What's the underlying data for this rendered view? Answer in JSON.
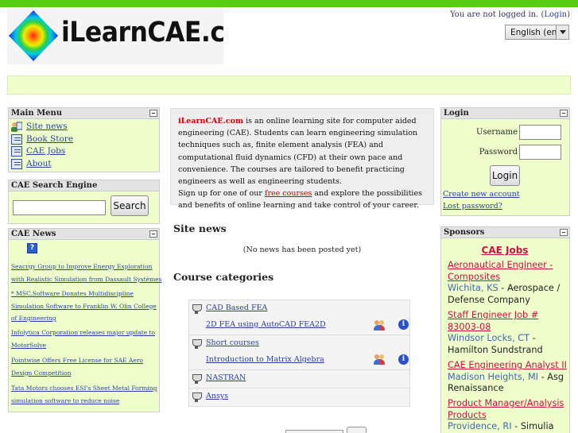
{
  "header": {
    "logo_text": "iLearnCAE.com",
    "login_status": "You are not logged in.",
    "login_link": "Login",
    "language": "English (en)"
  },
  "main_menu": {
    "title": "Main Menu",
    "items": [
      {
        "label": "Site news",
        "icon": "news-icon"
      },
      {
        "label": "Book Store",
        "icon": "document-icon"
      },
      {
        "label": "CAE Jobs",
        "icon": "document-icon"
      },
      {
        "label": "About",
        "icon": "document-icon"
      }
    ]
  },
  "search_block": {
    "title": "CAE Search Engine",
    "button": "Search",
    "query": ""
  },
  "news_block": {
    "title": "CAE News",
    "items": [
      "Seacrgy Group to Improve Energy Exploration with Realistic Simulation from Dassault Systèmes",
      "* MSC.Software Donates Multidiscipline Simulation Software to Franklin W. Olin College of Engineering",
      "Infolytica Corporation releases major update to MotorSolve",
      "Pointwise Offers Free License for SAE Aero Design Competition",
      "Tata Motors chooses ESI's Sheet Metal Forming simulation software to reduce noise"
    ]
  },
  "intro": {
    "brand": "iLearnCAE.com",
    "text1": " is an online learning site for computer aided engineering (CAE). Students can learn engineering simulation techniques such as, finite element analysis (FEA) and computational fluid dynamics (CFD) at their own pace and convenience. The courses are tailored to benefit practicing engineers as well as engineering students.",
    "text2": "Sign up for one of our ",
    "link": "free courses",
    "text3": " and explore the possibilities and benefits of online learning and take control of your career."
  },
  "site_news": {
    "title": "Site news",
    "empty": "(No news has been posted yet)"
  },
  "categories": {
    "title": "Course categories",
    "rows": [
      {
        "name": "CAD Based FEA",
        "course": "2D FEA using AutoCAD FEA2D"
      },
      {
        "name": "Short courses",
        "course": "Introduction to Matrix Algebra"
      },
      {
        "name": "NASTRAN"
      },
      {
        "name": "Ansys"
      }
    ]
  },
  "login": {
    "title": "Login",
    "username_label": "Username",
    "password_label": "Password",
    "button": "Login",
    "create_account": "Create new account",
    "lost_password": "Lost password?"
  },
  "sponsors": {
    "title": "Sponsors",
    "heading": "CAE Jobs",
    "jobs": [
      {
        "title": "Aeronautical Engineer - Composites",
        "location": "Wichita, KS",
        "company": "Aerospace / Defense Company"
      },
      {
        "title": "Staff Engineer Job # 83003-08",
        "location": "Windsor Locks, CT",
        "company": "Hamilton Sundstrand"
      },
      {
        "title": "CAE Engineering Analyst II",
        "location": "Madison Heights, MI",
        "company": "Asg Renaissance"
      },
      {
        "title": "Product Manager/Analysis Products",
        "location": "Providence, RI",
        "company": "Simulia"
      }
    ]
  },
  "colors": {
    "green_bar": "#55cc11",
    "block_bg": "#eeffcc",
    "link": "#2a3fa0",
    "accent_red": "#cc1144"
  }
}
